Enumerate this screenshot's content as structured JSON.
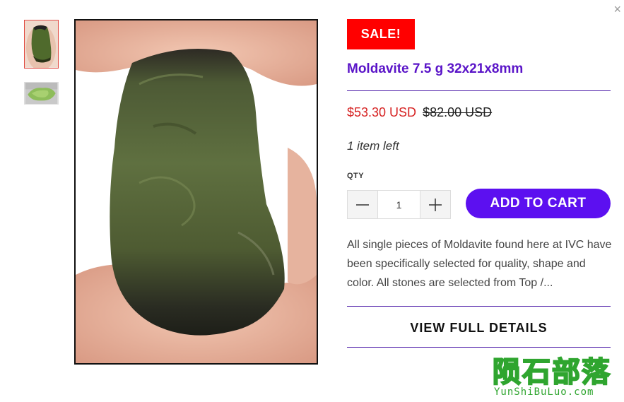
{
  "close": {
    "label": "×"
  },
  "product": {
    "sale_badge": "SALE!",
    "title": "Moldavite 7.5 g 32x21x8mm",
    "price": "$53.30 USD",
    "compare_price": "$82.00 USD",
    "stock": "1 item left",
    "qty_label": "QTY",
    "qty_value": "1",
    "add_to_cart": "ADD TO CART",
    "description": "All single pieces of Moldavite found here at IVC have been specifically selected for quality, shape and color. All stones are selected from Top /...",
    "view_details": "VIEW FULL DETAILS"
  },
  "watermark": {
    "chinese": "陨石部落",
    "english": "YunShiBuLuo.com"
  },
  "colors": {
    "sale_red": "#ff0000",
    "title_purple": "#5a14c8",
    "cart_purple": "#5c10f0",
    "price_red": "#d62222",
    "watermark_green": "#2fa52f"
  },
  "icons": {
    "close": "close-icon",
    "minus": "minus-icon",
    "plus": "plus-icon"
  }
}
